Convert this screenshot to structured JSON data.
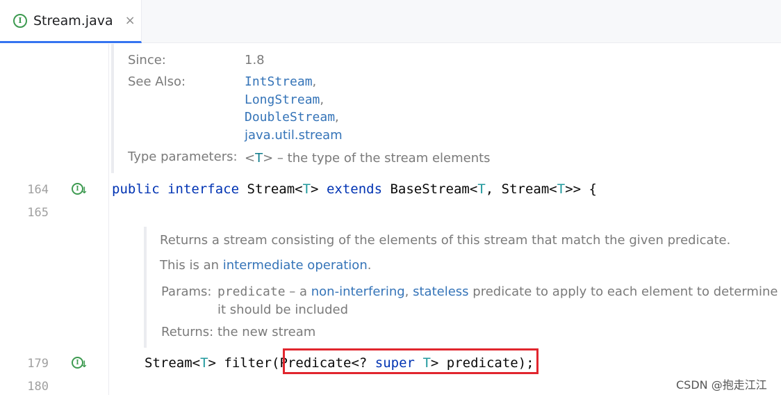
{
  "tab": {
    "title": "Stream.java",
    "icon_letter": "I",
    "close": "×"
  },
  "javadoc_top": {
    "since_label": "Since:",
    "since_value": "1.8",
    "see_also_label": "See Also:",
    "see_also": [
      "IntStream",
      "LongStream",
      "DoubleStream",
      "java.util.stream"
    ],
    "comma": ",",
    "type_params_label": "Type parameters:",
    "type_param_open": "<",
    "type_param_name": "T",
    "type_param_close": ">",
    "type_param_desc": " – the type of the stream elements"
  },
  "line_numbers": [
    "164",
    "165",
    "179",
    "180"
  ],
  "line164": {
    "kw1": "public",
    "kw2": "interface",
    "name": "Stream",
    "lt": "<",
    "t": "T",
    "gt": ">",
    "kw3": "extends",
    "base": "BaseStream",
    "mid": ", Stream<",
    "end": ">> {"
  },
  "javadoc_filter": {
    "summary": "Returns a stream consisting of the elements of this stream that match the given predicate.",
    "intermediate_prefix": "This is an ",
    "intermediate_link": "intermediate operation",
    "intermediate_suffix": ".",
    "params_label": "Params:",
    "param_name": "predicate",
    "param_dash": " – a ",
    "param_link1": "non-interfering",
    "param_comma": ", ",
    "param_link2": "stateless",
    "param_rest": " predicate to apply to each element to determine if",
    "param_line2": "it should be included",
    "returns_label": "Returns:",
    "returns_value": "the new stream"
  },
  "line179": {
    "type": "Stream<",
    "t": "T",
    "gt": "> ",
    "method": "filter(",
    "ptype": "Predicate<? ",
    "kw": "super",
    "sp": " ",
    "t2": "T",
    "rest": "> predicate",
    "end": ");"
  },
  "watermark": "CSDN @抱走江江",
  "colors": {
    "keyword": "#0033b3",
    "type_var": "#20999d",
    "link": "#3574b8",
    "highlight": "#e1262e",
    "icon": "#3d9a50",
    "tab_underline": "#3574f0"
  }
}
